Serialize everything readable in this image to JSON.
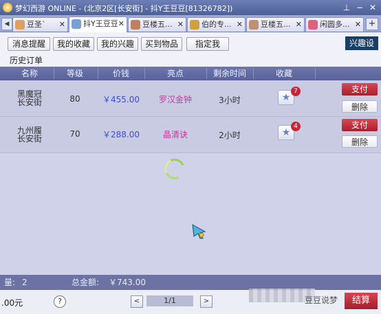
{
  "window": {
    "title": "梦幻西游 ONLINE - (北京2区[长安街] - 抖Y王豆豆[81326782])"
  },
  "tabs": [
    {
      "label": "豆圣`",
      "active": false,
      "avatar_color": "#e0a060"
    },
    {
      "label": "抖Y王豆豆",
      "active": true,
      "avatar_color": "#7aa0d8"
    },
    {
      "label": "豆楼五...",
      "active": false,
      "avatar_color": "#c08060"
    },
    {
      "label": "伯的专...",
      "active": false,
      "avatar_color": "#d0a040"
    },
    {
      "label": "豆楼五...",
      "active": false,
      "avatar_color": "#c09070"
    },
    {
      "label": "闲圆多...",
      "active": false,
      "avatar_color": "#e06080"
    }
  ],
  "toolbar": {
    "buttons": [
      "消息提醒",
      "我的收藏",
      "我的兴趣",
      "买到物品",
      "指定我"
    ],
    "interest_label": "兴趣设"
  },
  "section_title": "历史订单",
  "table": {
    "headers": [
      "名称",
      "等级",
      "价钱",
      "亮点",
      "剩余时间",
      "收藏"
    ],
    "rows": [
      {
        "name_line1": "黑魔冠",
        "name_line2": "长安街",
        "level": "80",
        "price": "￥455.00",
        "highlight": "罗汉金钟",
        "remaining": "3小时",
        "favorites": "7",
        "pay": "支付",
        "remove": "删除"
      },
      {
        "name_line1": "九州履",
        "name_line2": "长安街",
        "level": "70",
        "price": "￥288.00",
        "highlight": "晶清诀",
        "remaining": "2小时",
        "favorites": "4",
        "pay": "支付",
        "remove": "删除"
      }
    ]
  },
  "summary": {
    "count_label": "量:",
    "count_value": "2",
    "total_label": "总金额:",
    "total_value": "￥743.00"
  },
  "footer": {
    "balance": ".00元",
    "help": "?",
    "page_prev": "<",
    "page_next": ">",
    "page_indicator": "1/1",
    "watermark": "豆豆说梦",
    "checkout": "结算"
  },
  "colors": {
    "pay_button": "#c22f3c",
    "price_text": "#3a4ed0",
    "highlight_text": "#c73aa0",
    "header_bg": "#5f68a0"
  }
}
